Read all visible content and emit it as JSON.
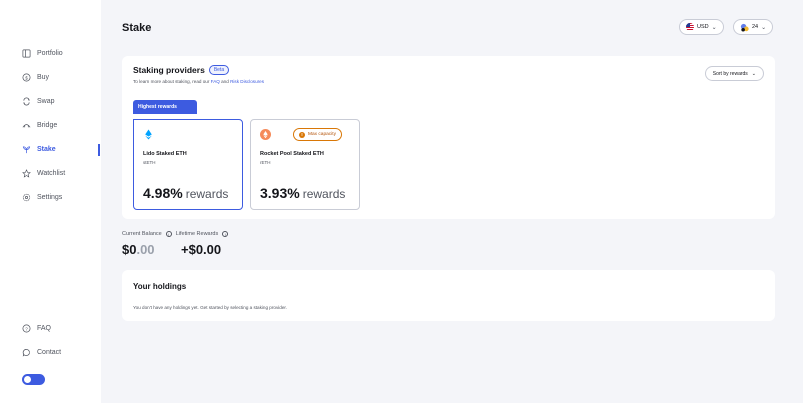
{
  "sidebar": {
    "items": [
      {
        "label": "Portfolio",
        "icon": "portfolio-icon"
      },
      {
        "label": "Buy",
        "icon": "buy-icon"
      },
      {
        "label": "Swap",
        "icon": "swap-icon"
      },
      {
        "label": "Bridge",
        "icon": "bridge-icon"
      },
      {
        "label": "Stake",
        "icon": "stake-icon",
        "active": true
      },
      {
        "label": "Watchlist",
        "icon": "star-icon"
      },
      {
        "label": "Settings",
        "icon": "gear-icon"
      }
    ],
    "bottom": [
      {
        "label": "FAQ",
        "icon": "question-icon"
      },
      {
        "label": "Contact",
        "icon": "chat-icon"
      }
    ],
    "accent": "#3d5be0"
  },
  "header": {
    "title": "Stake",
    "currency": "USD",
    "network_count": "24"
  },
  "providers": {
    "title": "Staking providers",
    "beta": "Beta",
    "sub_prefix": "To learn more about staking, read our",
    "faq_link": "FAQ",
    "and": "and",
    "risk_link": "Risk Disclosures",
    "sort_label": "Sort by rewards",
    "highest_badge": "Highest rewards",
    "list": [
      {
        "name": "Lido Staked ETH",
        "symbol": "stETH",
        "rate": "4.98%",
        "unit": "rewards",
        "icon": "lido-icon",
        "color": "#00a3ff"
      },
      {
        "name": "Rocket Pool Staked ETH",
        "symbol": "rETH",
        "rate": "3.93%",
        "unit": "rewards",
        "icon": "rocketpool-icon",
        "color": "#f58a5a",
        "badge": "Max capacity"
      }
    ]
  },
  "balance": {
    "current_label": "Current Balance",
    "lifetime_label": "Lifetime Rewards",
    "current_whole": "$0",
    "current_cents": ".00",
    "lifetime_value": "+$0.00"
  },
  "holdings": {
    "title": "Your holdings",
    "empty": "You don't have any holdings yet. Get started by selecting a staking provider."
  }
}
